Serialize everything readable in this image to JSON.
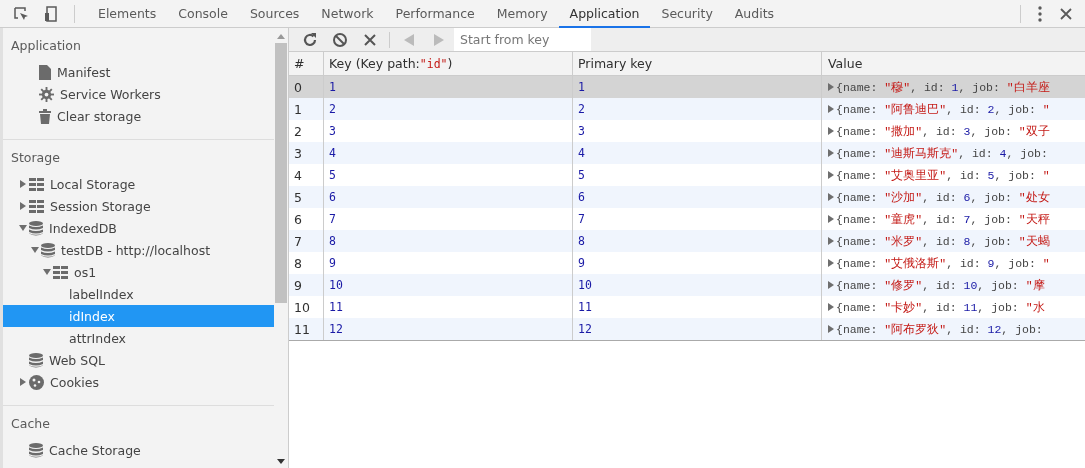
{
  "tabs": [
    {
      "label": "Elements",
      "selected": false
    },
    {
      "label": "Console",
      "selected": false
    },
    {
      "label": "Sources",
      "selected": false
    },
    {
      "label": "Network",
      "selected": false
    },
    {
      "label": "Performance",
      "selected": false
    },
    {
      "label": "Memory",
      "selected": false
    },
    {
      "label": "Application",
      "selected": true
    },
    {
      "label": "Security",
      "selected": false
    },
    {
      "label": "Audits",
      "selected": false
    }
  ],
  "sidebar": {
    "sections": [
      {
        "title": "Application",
        "items": [
          {
            "label": "Manifest",
            "kind": "file"
          },
          {
            "label": "Service Workers",
            "kind": "gear"
          },
          {
            "label": "Clear storage",
            "kind": "trash"
          }
        ]
      },
      {
        "title": "Storage",
        "items": [
          {
            "label": "Local Storage",
            "kind": "table",
            "expanded": false,
            "selected": false
          },
          {
            "label": "Session Storage",
            "kind": "table",
            "expanded": false,
            "selected": false
          },
          {
            "label": "IndexedDB",
            "kind": "database",
            "expanded": true,
            "selected": false,
            "children": [
              {
                "label": "testDB - http://localhost",
                "kind": "database",
                "expanded": true,
                "selected": false,
                "children": [
                  {
                    "label": "os1",
                    "kind": "table",
                    "expanded": true,
                    "selected": false,
                    "children": [
                      {
                        "label": "labelIndex",
                        "selected": false
                      },
                      {
                        "label": "idIndex",
                        "selected": true
                      },
                      {
                        "label": "attrIndex",
                        "selected": false
                      }
                    ]
                  }
                ]
              }
            ]
          },
          {
            "label": "Web SQL",
            "kind": "database",
            "selected": false
          },
          {
            "label": "Cookies",
            "kind": "cookie",
            "expanded": false,
            "selected": false
          }
        ]
      },
      {
        "title": "Cache",
        "items": [
          {
            "label": "Cache Storage",
            "kind": "database"
          }
        ]
      }
    ]
  },
  "toolbar": {
    "buttons": [
      {
        "kind": "refresh",
        "disabled": false
      },
      {
        "kind": "clear",
        "disabled": false
      },
      {
        "kind": "delete",
        "disabled": false
      },
      {
        "kind": "previous",
        "disabled": true
      },
      {
        "kind": "next",
        "disabled": true
      }
    ],
    "search": {
      "placeholder": "Start from key"
    }
  },
  "table": {
    "columns": [
      {
        "label": [
          {
            "kind": "plain",
            "text": "#"
          }
        ]
      },
      {
        "label": [
          {
            "kind": "plain",
            "text": "Key (Key path: "
          },
          {
            "kind": "string",
            "text": "\"id\""
          },
          {
            "kind": "plain",
            "text": ")"
          }
        ]
      },
      {
        "label": [
          {
            "kind": "plain",
            "text": "Primary key"
          }
        ]
      },
      {
        "label": [
          {
            "kind": "plain",
            "text": "Value"
          }
        ]
      }
    ],
    "rows": [
      {
        "index": "0",
        "key": "1",
        "primary_key": "1",
        "selected": true,
        "value": [
          {
            "kind": "punct",
            "text": "{name: "
          },
          {
            "kind": "string",
            "text": "\"穆\""
          },
          {
            "kind": "punct",
            "text": ", id: "
          },
          {
            "kind": "number",
            "text": "1"
          },
          {
            "kind": "punct",
            "text": ", job: "
          },
          {
            "kind": "string",
            "text": "\"白羊座"
          }
        ]
      },
      {
        "index": "1",
        "key": "2",
        "primary_key": "2",
        "selected": false,
        "value": [
          {
            "kind": "punct",
            "text": "{name: "
          },
          {
            "kind": "string",
            "text": "\"阿鲁迪巴\""
          },
          {
            "kind": "punct",
            "text": ", id: "
          },
          {
            "kind": "number",
            "text": "2"
          },
          {
            "kind": "punct",
            "text": ", job: "
          },
          {
            "kind": "string",
            "text": "\""
          }
        ]
      },
      {
        "index": "2",
        "key": "3",
        "primary_key": "3",
        "selected": false,
        "value": [
          {
            "kind": "punct",
            "text": "{name: "
          },
          {
            "kind": "string",
            "text": "\"撒加\""
          },
          {
            "kind": "punct",
            "text": ", id: "
          },
          {
            "kind": "number",
            "text": "3"
          },
          {
            "kind": "punct",
            "text": ", job: "
          },
          {
            "kind": "string",
            "text": "\"双子"
          }
        ]
      },
      {
        "index": "3",
        "key": "4",
        "primary_key": "4",
        "selected": false,
        "value": [
          {
            "kind": "punct",
            "text": "{name: "
          },
          {
            "kind": "string",
            "text": "\"迪斯马斯克\""
          },
          {
            "kind": "punct",
            "text": ", id: "
          },
          {
            "kind": "number",
            "text": "4"
          },
          {
            "kind": "punct",
            "text": ", job:"
          }
        ]
      },
      {
        "index": "4",
        "key": "5",
        "primary_key": "5",
        "selected": false,
        "value": [
          {
            "kind": "punct",
            "text": "{name: "
          },
          {
            "kind": "string",
            "text": "\"艾奥里亚\""
          },
          {
            "kind": "punct",
            "text": ", id: "
          },
          {
            "kind": "number",
            "text": "5"
          },
          {
            "kind": "punct",
            "text": ", job: "
          },
          {
            "kind": "string",
            "text": "\""
          }
        ]
      },
      {
        "index": "5",
        "key": "6",
        "primary_key": "6",
        "selected": false,
        "value": [
          {
            "kind": "punct",
            "text": "{name: "
          },
          {
            "kind": "string",
            "text": "\"沙加\""
          },
          {
            "kind": "punct",
            "text": ", id: "
          },
          {
            "kind": "number",
            "text": "6"
          },
          {
            "kind": "punct",
            "text": ", job: "
          },
          {
            "kind": "string",
            "text": "\"处女"
          }
        ]
      },
      {
        "index": "6",
        "key": "7",
        "primary_key": "7",
        "selected": false,
        "value": [
          {
            "kind": "punct",
            "text": "{name: "
          },
          {
            "kind": "string",
            "text": "\"童虎\""
          },
          {
            "kind": "punct",
            "text": ", id: "
          },
          {
            "kind": "number",
            "text": "7"
          },
          {
            "kind": "punct",
            "text": ", job: "
          },
          {
            "kind": "string",
            "text": "\"天秤"
          }
        ]
      },
      {
        "index": "7",
        "key": "8",
        "primary_key": "8",
        "selected": false,
        "value": [
          {
            "kind": "punct",
            "text": "{name: "
          },
          {
            "kind": "string",
            "text": "\"米罗\""
          },
          {
            "kind": "punct",
            "text": ", id: "
          },
          {
            "kind": "number",
            "text": "8"
          },
          {
            "kind": "punct",
            "text": ", job: "
          },
          {
            "kind": "string",
            "text": "\"天蝎"
          }
        ]
      },
      {
        "index": "8",
        "key": "9",
        "primary_key": "9",
        "selected": false,
        "value": [
          {
            "kind": "punct",
            "text": "{name: "
          },
          {
            "kind": "string",
            "text": "\"艾俄洛斯\""
          },
          {
            "kind": "punct",
            "text": ", id: "
          },
          {
            "kind": "number",
            "text": "9"
          },
          {
            "kind": "punct",
            "text": ", job: "
          },
          {
            "kind": "string",
            "text": "\""
          }
        ]
      },
      {
        "index": "9",
        "key": "10",
        "primary_key": "10",
        "selected": false,
        "value": [
          {
            "kind": "punct",
            "text": "{name: "
          },
          {
            "kind": "string",
            "text": "\"修罗\""
          },
          {
            "kind": "punct",
            "text": ", id: "
          },
          {
            "kind": "number",
            "text": "10"
          },
          {
            "kind": "punct",
            "text": ", job: "
          },
          {
            "kind": "string",
            "text": "\"摩"
          }
        ]
      },
      {
        "index": "10",
        "key": "11",
        "primary_key": "11",
        "selected": false,
        "value": [
          {
            "kind": "punct",
            "text": "{name: "
          },
          {
            "kind": "string",
            "text": "\"卡妙\""
          },
          {
            "kind": "punct",
            "text": ", id: "
          },
          {
            "kind": "number",
            "text": "11"
          },
          {
            "kind": "punct",
            "text": ", job: "
          },
          {
            "kind": "string",
            "text": "\"水"
          }
        ]
      },
      {
        "index": "11",
        "key": "12",
        "primary_key": "12",
        "selected": false,
        "value": [
          {
            "kind": "punct",
            "text": "{name: "
          },
          {
            "kind": "string",
            "text": "\"阿布罗狄\""
          },
          {
            "kind": "punct",
            "text": ", id: "
          },
          {
            "kind": "number",
            "text": "12"
          },
          {
            "kind": "punct",
            "text": ", job:"
          }
        ]
      }
    ]
  }
}
